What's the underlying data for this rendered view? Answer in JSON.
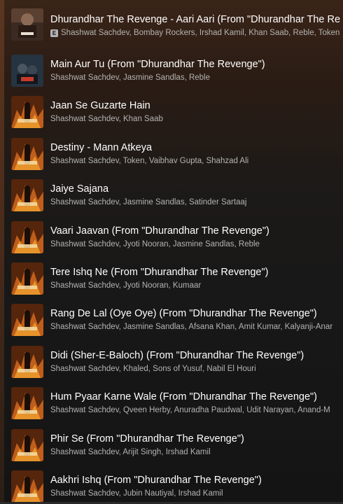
{
  "tracks": [
    {
      "title": "Dhurandhar The Revenge - Aari Aari (From \"Dhurandhar The Re",
      "artists": "Shashwat Sachdev, Bombay Rockers, Irshad Kamil, Khan Saab, Reble, Token",
      "explicit": true,
      "cover": "aari-aari-cover"
    },
    {
      "title": "Main Aur Tu (From \"Dhurandhar The Revenge\")",
      "artists": "Shashwat Sachdev, Jasmine Sandlas, Reble",
      "explicit": false,
      "cover": "main-aur-tu-cover"
    },
    {
      "title": "Jaan Se Guzarte Hain",
      "artists": "Shashwat Sachdev, Khan Saab",
      "explicit": false,
      "cover": "dhurandhar-cover"
    },
    {
      "title": "Destiny - Mann Atkeya",
      "artists": "Shashwat Sachdev, Token, Vaibhav Gupta, Shahzad Ali",
      "explicit": false,
      "cover": "dhurandhar-cover"
    },
    {
      "title": "Jaiye Sajana",
      "artists": "Shashwat Sachdev, Jasmine Sandlas, Satinder Sartaaj",
      "explicit": false,
      "cover": "dhurandhar-cover"
    },
    {
      "title": "Vaari Jaavan (From \"Dhurandhar The Revenge\")",
      "artists": "Shashwat Sachdev, Jyoti Nooran, Jasmine Sandlas, Reble",
      "explicit": false,
      "cover": "dhurandhar-cover"
    },
    {
      "title": "Tere Ishq Ne (From \"Dhurandhar The Revenge\")",
      "artists": "Shashwat Sachdev, Jyoti Nooran, Kumaar",
      "explicit": false,
      "cover": "dhurandhar-cover"
    },
    {
      "title": "Rang De Lal (Oye Oye) (From \"Dhurandhar The Revenge\")",
      "artists": "Shashwat Sachdev, Jasmine Sandlas, Afsana Khan, Amit Kumar, Kalyanji-Anar",
      "explicit": false,
      "cover": "dhurandhar-cover"
    },
    {
      "title": "Didi (Sher-E-Baloch) (From \"Dhurandhar The Revenge\")",
      "artists": "Shashwat Sachdev, Khaled, Sons of Yusuf, Nabil El Houri",
      "explicit": false,
      "cover": "dhurandhar-cover"
    },
    {
      "title": "Hum Pyaar Karne Wale (From \"Dhurandhar The Revenge\")",
      "artists": "Shashwat Sachdev, Qveen Herby, Anuradha Paudwal, Udit Narayan, Anand-M",
      "explicit": false,
      "cover": "dhurandhar-cover"
    },
    {
      "title": "Phir Se (From \"Dhurandhar The Revenge\")",
      "artists": "Shashwat Sachdev, Arijit Singh, Irshad Kamil",
      "explicit": false,
      "cover": "dhurandhar-cover"
    },
    {
      "title": "Aakhri Ishq (From \"Dhurandhar The Revenge\")",
      "artists": "Shashwat Sachdev, Jubin Nautiyal, Irshad Kamil",
      "explicit": false,
      "cover": "dhurandhar-cover"
    }
  ],
  "explicit_badge": "E",
  "colors": {
    "background": "#181818",
    "title_text": "#ffffff",
    "subtitle_text": "#b3b3b3",
    "cover_fire": "#d2691e"
  }
}
